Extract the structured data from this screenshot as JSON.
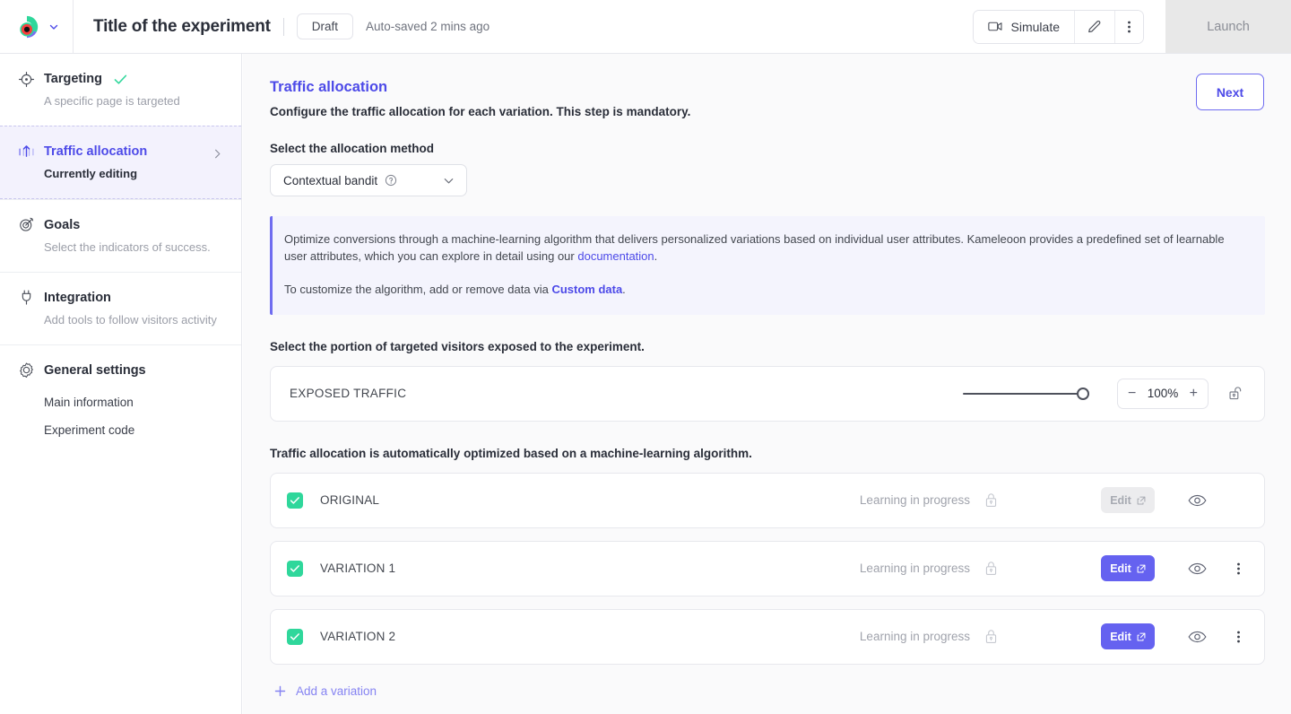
{
  "topbar": {
    "logo_icon": "kameleoon-logo",
    "brand_caret_icon": "chevron-down-icon",
    "experiment_title": "Title of the experiment",
    "status": "Draft",
    "autosave": "Auto-saved 2 mins ago",
    "simulate_label": "Simulate",
    "simulate_icon": "video-camera-icon",
    "edit_icon": "pencil-icon",
    "more_icon": "kebab-menu-icon",
    "launch_label": "Launch"
  },
  "sidebar": {
    "items": [
      {
        "label": "Targeting",
        "sub": "A specific page is targeted",
        "icon": "crosshair-icon",
        "complete": true,
        "active": false
      },
      {
        "label": "Traffic allocation",
        "sub": "Currently editing",
        "icon": "traffic-allocation-icon",
        "complete": false,
        "active": true
      },
      {
        "label": "Goals",
        "sub": "Select the indicators of success.",
        "icon": "goal-target-icon",
        "complete": false,
        "active": false
      },
      {
        "label": "Integration",
        "sub": "Add tools to follow visitors activity",
        "icon": "plug-icon",
        "complete": false,
        "active": false
      },
      {
        "label": "General settings",
        "sub": "",
        "icon": "gear-icon",
        "complete": false,
        "active": false
      }
    ],
    "sub_links": [
      {
        "label": "Main information"
      },
      {
        "label": "Experiment code"
      }
    ]
  },
  "main": {
    "page_title": "Traffic allocation",
    "page_desc": "Configure the traffic allocation for each variation. This step is mandatory.",
    "next_label": "Next",
    "method_label": "Select the allocation method",
    "method_value": "Contextual bandit",
    "method_help_icon": "question-circle-icon",
    "method_caret_icon": "chevron-down-icon",
    "info": {
      "p1_a": "Optimize conversions through a machine-learning algorithm that delivers personalized variations based on individual user attributes. Kameleoon provides a predefined set of learnable user attributes, which you can explore in detail using our ",
      "p1_link": "documentation",
      "p1_b": ".",
      "p2_a": "To customize the algorithm, add or remove data via ",
      "p2_link": "Custom data",
      "p2_b": "."
    },
    "exposure_label": "Select the portion of targeted visitors exposed to the experiment.",
    "exposed_traffic_label": "EXPOSED TRAFFIC",
    "exposed_value": "100%",
    "exposed_percent": 100,
    "minus_label": "−",
    "plus_label": "+",
    "lock_icon": "padlock-open-icon",
    "allocation_note": "Traffic allocation is automatically optimized based on a machine-learning algorithm.",
    "variations": [
      {
        "name": "ORIGINAL",
        "checked": true,
        "status": "Learning in progress",
        "lock_icon": "padlock-closed-icon",
        "edit_label": "Edit",
        "edit_disabled": true,
        "has_kebab": false
      },
      {
        "name": "VARIATION 1",
        "checked": true,
        "status": "Learning in progress",
        "lock_icon": "padlock-closed-icon",
        "edit_label": "Edit",
        "edit_disabled": false,
        "has_kebab": true
      },
      {
        "name": "VARIATION 2",
        "checked": true,
        "status": "Learning in progress",
        "lock_icon": "padlock-closed-icon",
        "edit_label": "Edit",
        "edit_disabled": false,
        "has_kebab": true
      }
    ],
    "add_variation_label": "Add a variation",
    "add_variation_icon": "plus-icon"
  },
  "colors": {
    "accent_purple": "#4d4ae8",
    "button_purple": "#6562f0",
    "link_purple": "#8583f2",
    "check_green": "#2fd79b",
    "info_bg": "#f4f4fd",
    "canvas": "#fafafb"
  }
}
